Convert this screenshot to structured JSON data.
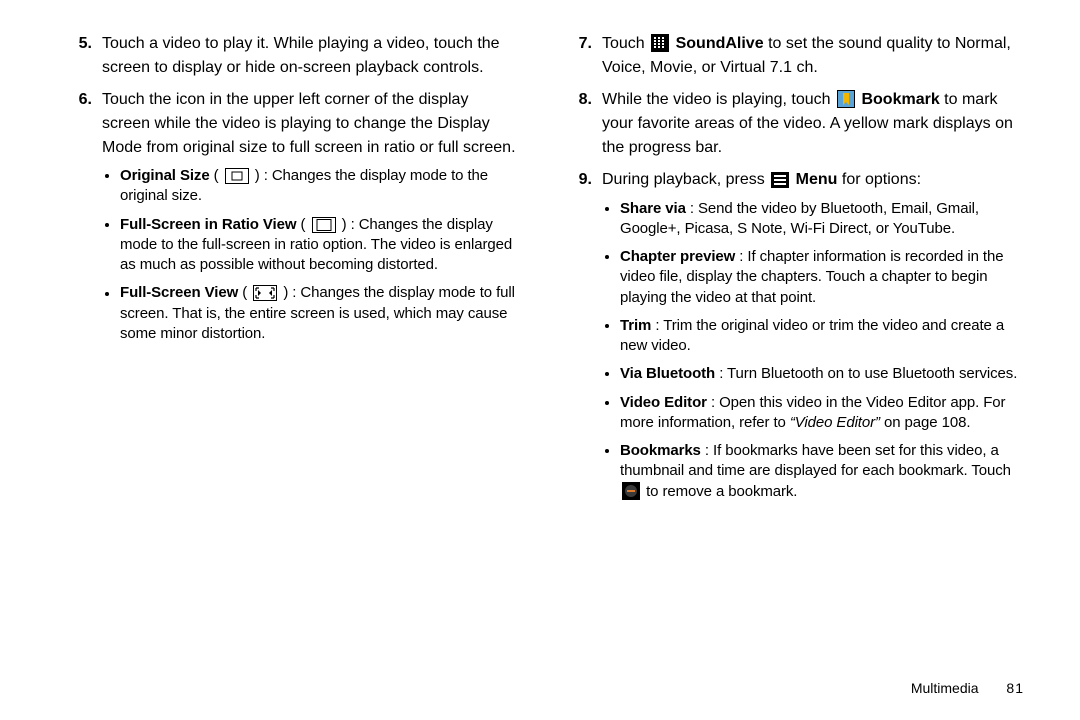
{
  "left": {
    "step5": {
      "num": "5.",
      "text": "Touch a video to play it. While playing a video, touch the screen to display or hide on-screen playback controls."
    },
    "step6": {
      "num": "6.",
      "text": "Touch the icon in the upper left corner of the display screen while the video is playing to change the Display Mode from original size to full screen in ratio or full screen.",
      "bullets": {
        "orig_label": "Original Size",
        "orig_text": ": Changes the display mode to the original size.",
        "ratio_label": "Full-Screen in Ratio View",
        "ratio_text": ": Changes the display mode to the full-screen in ratio option. The video is enlarged as much as possible without becoming distorted.",
        "full_label": "Full-Screen View",
        "full_text": ": Changes the display mode to full screen. That is, the entire screen is used, which may cause some minor distortion."
      }
    }
  },
  "right": {
    "step7": {
      "num": "7.",
      "pre": "Touch ",
      "label": "SoundAlive",
      "post": " to set the sound quality to Normal, Voice, Movie, or Virtual 7.1 ch."
    },
    "step8": {
      "num": "8.",
      "pre": "While the video is playing, touch ",
      "label": "Bookmark",
      "post": " to mark your favorite areas of the video. A yellow mark displays on the progress bar."
    },
    "step9": {
      "num": "9.",
      "pre": "During playback, press ",
      "label": "Menu",
      "post": " for options:",
      "bullets": {
        "share_label": "Share via",
        "share_text": ": Send the video by Bluetooth, Email, Gmail, Google+, Picasa, S Note, Wi-Fi Direct, or YouTube.",
        "chapter_label": "Chapter preview",
        "chapter_text": ": If chapter information is recorded in the video file, display the chapters. Touch a chapter to begin playing the video at that point.",
        "trim_label": "Trim",
        "trim_text": ": Trim the original video or trim the video and create a new video.",
        "bt_label": "Via Bluetooth",
        "bt_text": ": Turn Bluetooth on to use Bluetooth services.",
        "editor_label": "Video Editor",
        "editor_pre": ": Open this video in the Video Editor app. For more information, refer to ",
        "editor_ref": "“Video Editor”",
        "editor_post": "  on page 108.",
        "bookmarks_label": "Bookmarks",
        "bookmarks_text": ": If bookmarks have been set for this video, a thumbnail and time are displayed for each bookmark. Touch ",
        "bookmarks_post": " to remove a bookmark."
      }
    }
  },
  "footer": {
    "section": "Multimedia",
    "page": "81"
  }
}
